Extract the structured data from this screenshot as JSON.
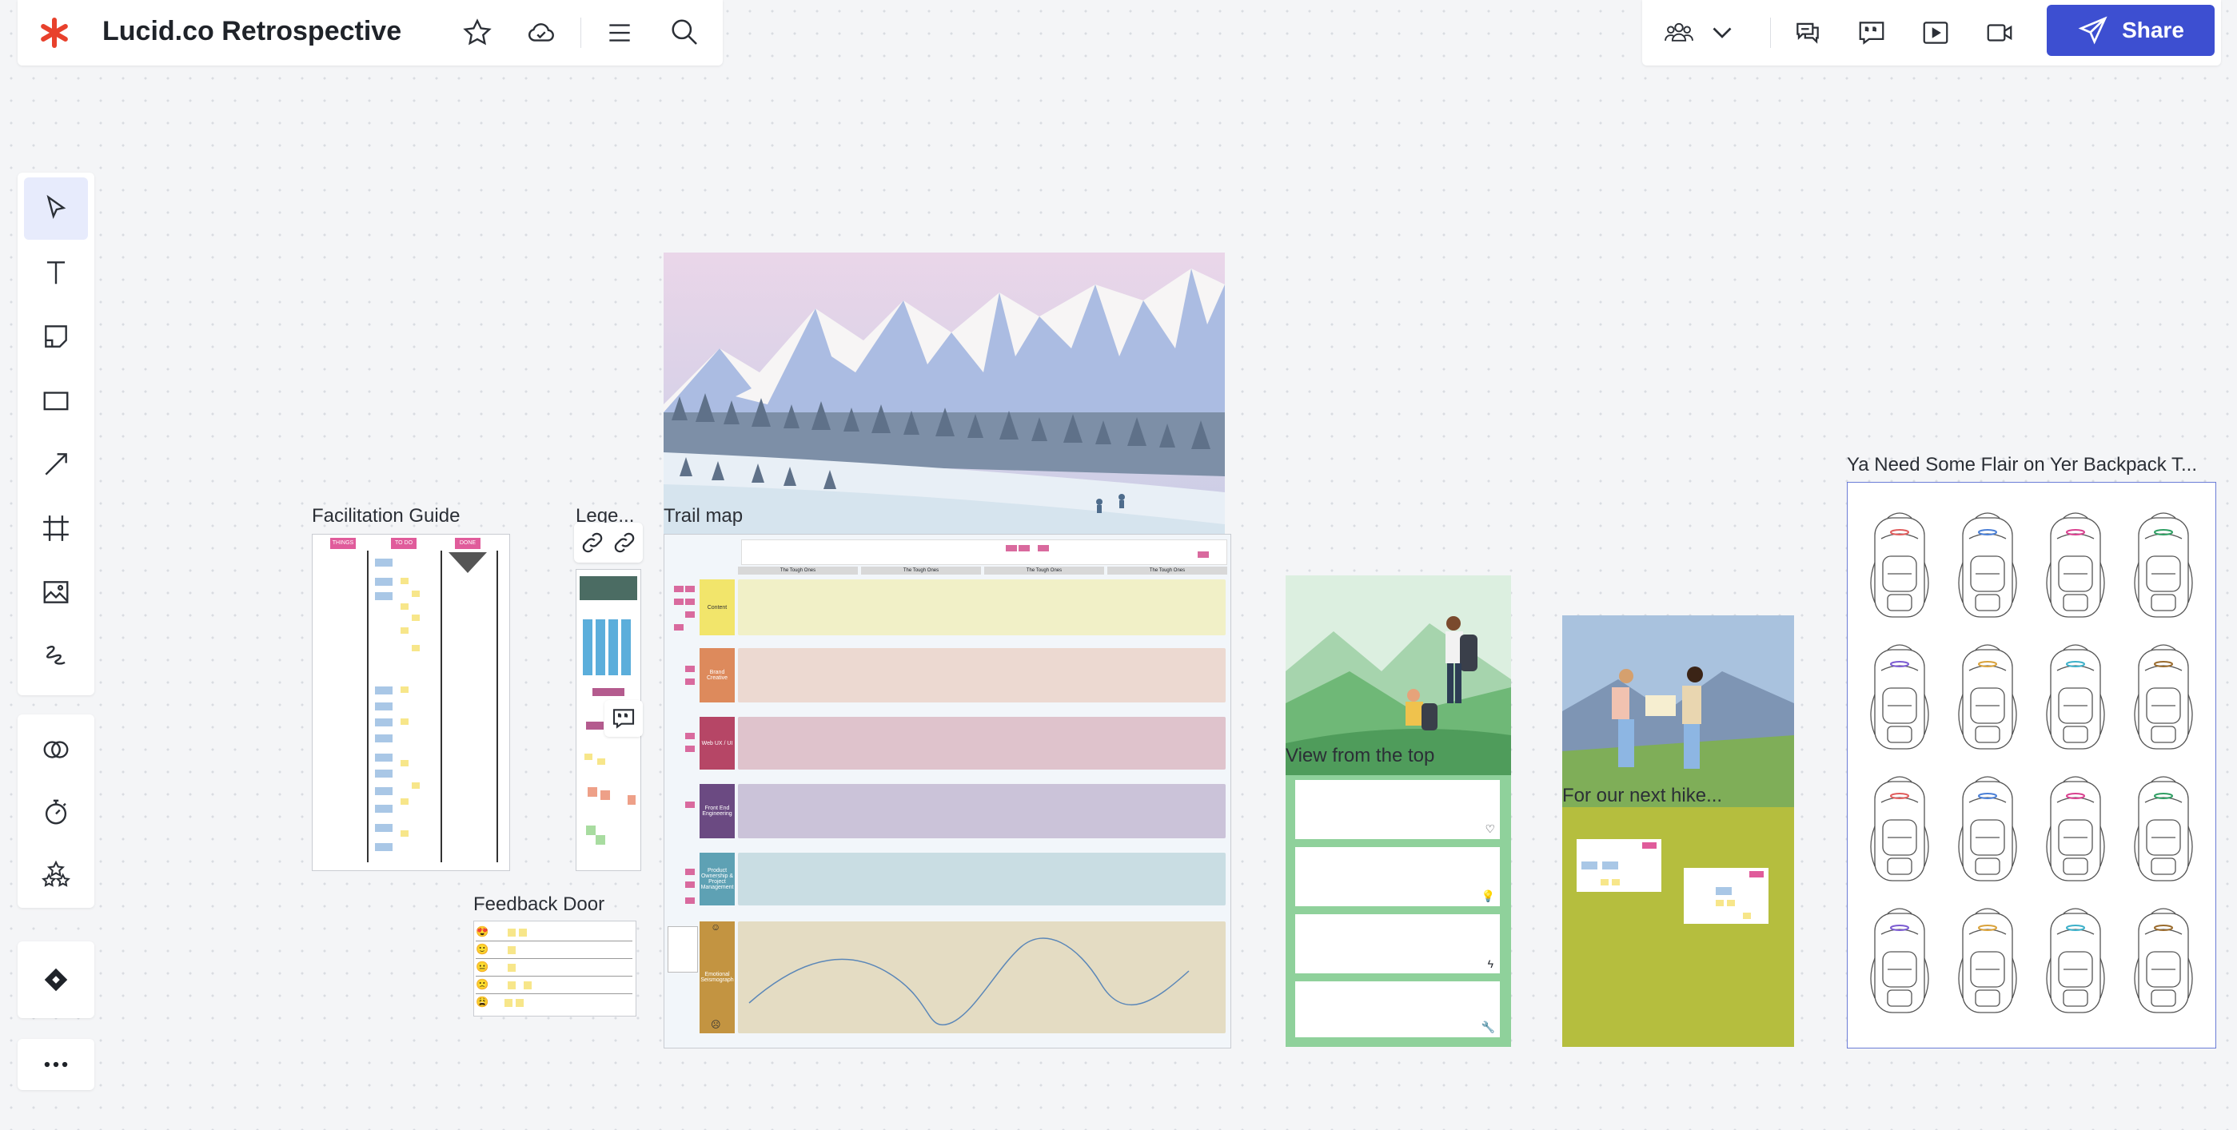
{
  "header": {
    "title": "Lucid.co Retrospective",
    "share_label": "Share"
  },
  "colors": {
    "brand": "#e8412c",
    "accent": "#3d4fd1",
    "selected_tool_bg": "#e7ebfc"
  },
  "toolbar_left": {
    "tools": [
      "select-icon",
      "text-icon",
      "sticky-note-icon",
      "rectangle-icon",
      "line-icon",
      "frame-icon",
      "image-icon",
      "freehand-icon"
    ],
    "extras": [
      "collaboration-icon",
      "timer-icon",
      "reactions-icon"
    ],
    "diamond": "integrations-icon",
    "more": "more-icon"
  },
  "frames": {
    "facilitation": {
      "label": "Facilitation Guide",
      "columns": [
        "THINGS",
        "TO DO",
        "DONE"
      ]
    },
    "legend": {
      "label": "Lege..."
    },
    "trail": {
      "label": "Trail map",
      "headers": [
        "The Tough Ones",
        "The Tough Ones",
        "The Tough Ones",
        "The Tough Ones"
      ],
      "rows": [
        {
          "label": "Content",
          "color": "#f2e56b",
          "fill": "#f1f0c7"
        },
        {
          "label": "Brand Creative",
          "color": "#dd8a5c",
          "fill": "#ecd9d1"
        },
        {
          "label": "Web UX / UI",
          "color": "#b64666",
          "fill": "#dfc3cc"
        },
        {
          "label": "Front End Engineering",
          "color": "#6b4a82",
          "fill": "#cbc3d9"
        },
        {
          "label": "Product Ownership & Project Management",
          "color": "#5ea1b4",
          "fill": "#c9dde3"
        },
        {
          "label": "Emotional Seismograph",
          "color": "#c39441",
          "fill": "#e4dcc3"
        }
      ]
    },
    "feedback": {
      "label": "Feedback Door",
      "faces": [
        "😍",
        "🙂",
        "😐",
        "🙁",
        "😩"
      ]
    },
    "view": {
      "label": "View from the top"
    },
    "hike": {
      "label": "For our next hike..."
    },
    "flair": {
      "label": "Ya Need Some Flair on Yer Backpack T..."
    }
  }
}
